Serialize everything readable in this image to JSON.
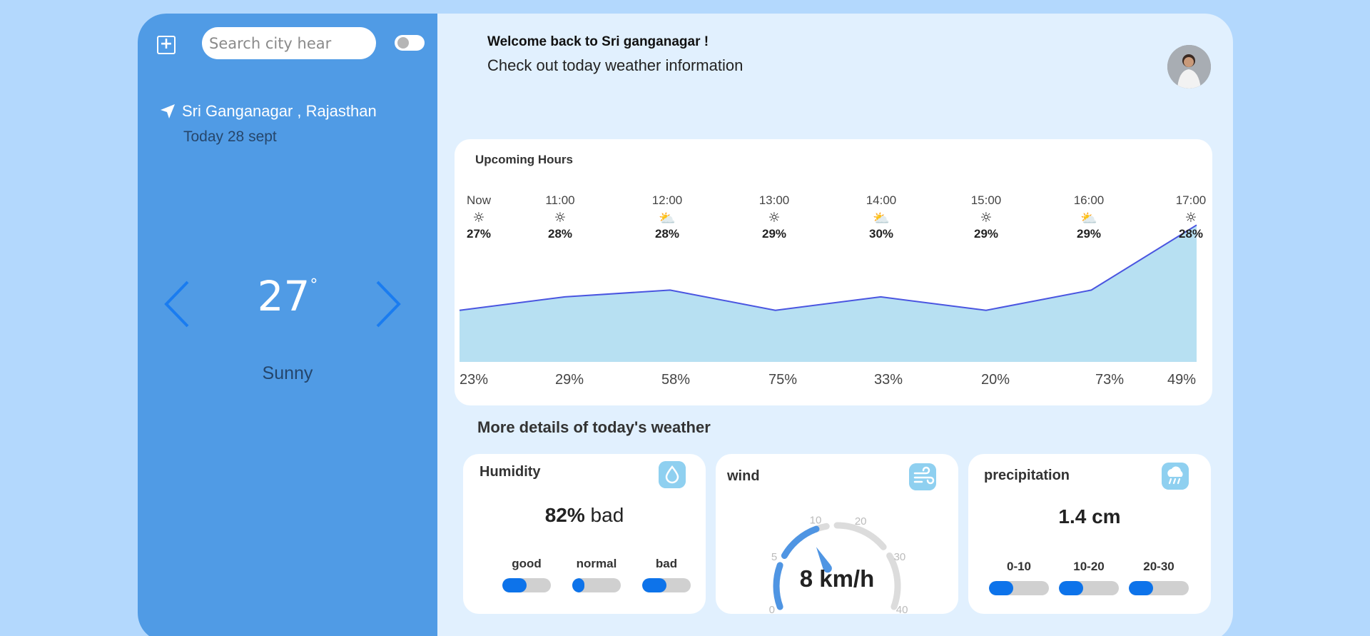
{
  "sidebar": {
    "search_placeholder": "Search city hear",
    "location": "Sri Ganganagar , Rajasthan",
    "date": "Today 28 sept",
    "temperature": "27",
    "temp_unit": "°",
    "condition": "Sunny"
  },
  "header": {
    "welcome": "Welcome back to Sri ganganagar !",
    "subtitle": "Check out today weather information"
  },
  "upcoming": {
    "title": "Upcoming Hours",
    "hours": [
      {
        "time": "Now",
        "icon": "sun-icon",
        "percent": "27%"
      },
      {
        "time": "11:00",
        "icon": "sun-icon",
        "percent": "28%"
      },
      {
        "time": "12:00",
        "icon": "partly-cloudy-icon",
        "percent": "28%"
      },
      {
        "time": "13:00",
        "icon": "sun-icon",
        "percent": "29%"
      },
      {
        "time": "14:00",
        "icon": "partly-cloudy-icon",
        "percent": "30%"
      },
      {
        "time": "15:00",
        "icon": "sun-icon",
        "percent": "29%"
      },
      {
        "time": "16:00",
        "icon": "partly-cloudy-icon",
        "percent": "29%"
      },
      {
        "time": "17:00",
        "icon": "sun-icon",
        "percent": "28%"
      }
    ],
    "bottom_labels": [
      "23%",
      "29%",
      "58%",
      "75%",
      "33%",
      "20%",
      "73%",
      "49%"
    ],
    "chart_series": [
      23,
      29,
      32,
      23,
      29,
      23,
      32,
      61
    ],
    "line_color": "#4a55e0",
    "area_color": "#b7e0f2"
  },
  "details": {
    "title": "More details of today's weather",
    "humidity": {
      "title": "Humidity",
      "value": "82%",
      "rating": "bad",
      "levels": [
        {
          "label": "good",
          "fill": 0.5
        },
        {
          "label": "normal",
          "fill": 0.25
        },
        {
          "label": "bad",
          "fill": 0.5
        }
      ]
    },
    "wind": {
      "title": "wind",
      "value": "8 km/h",
      "speed": 8,
      "ticks": [
        "0",
        "5",
        "10",
        "20",
        "30",
        "40"
      ]
    },
    "precipitation": {
      "title": "precipitation",
      "value": "1.4 cm",
      "levels": [
        {
          "label": "0-10",
          "fill": 0.4
        },
        {
          "label": "10-20",
          "fill": 0.4
        },
        {
          "label": "20-30",
          "fill": 0.4
        }
      ]
    }
  },
  "colors": {
    "accent": "#0d73ea",
    "sidebar": "#509be5",
    "background": "#b3d8fd"
  }
}
